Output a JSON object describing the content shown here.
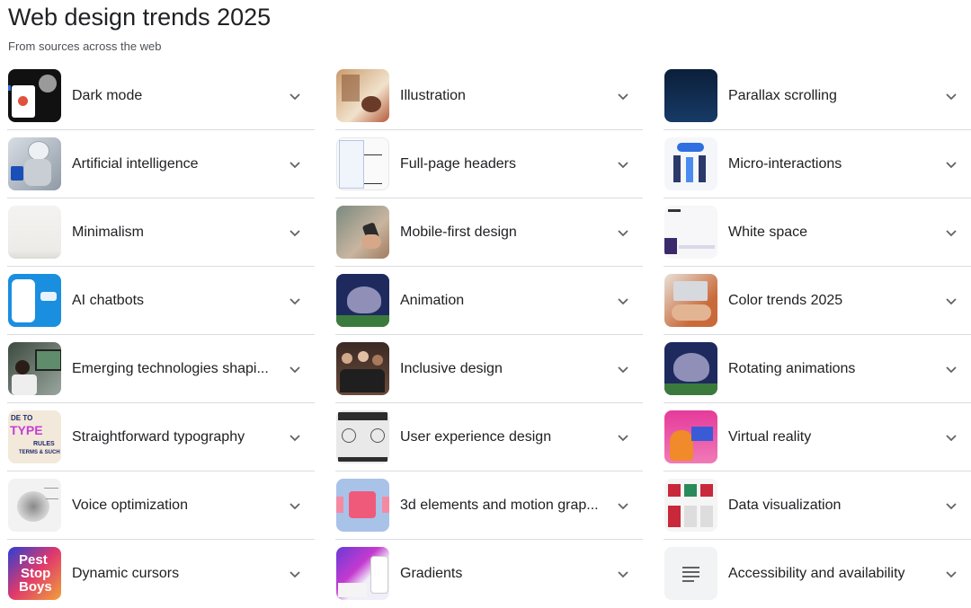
{
  "header": {
    "title": "Web design trends 2025",
    "subtitle": "From sources across the web"
  },
  "columns": [
    {
      "items": [
        {
          "label": "Dark mode",
          "thumb": "dark-mode-thumbnail"
        },
        {
          "label": "Artificial intelligence",
          "thumb": "robot-thumbnail"
        },
        {
          "label": "Minimalism",
          "thumb": "minimalism-thumbnail"
        },
        {
          "label": "AI chatbots",
          "thumb": "chatbot-thumbnail"
        },
        {
          "label": "Emerging technologies shapi...",
          "thumb": "workspace-thumbnail"
        },
        {
          "label": "Straightforward typography",
          "thumb": "typography-thumbnail",
          "thumb_text": [
            "DE TO",
            "TYPE",
            "RULES",
            "TERMS & SUCH"
          ]
        },
        {
          "label": "Voice optimization",
          "thumb": "voice-diagram-thumbnail"
        },
        {
          "label": "Dynamic cursors",
          "thumb": "pest-stop-boys-thumbnail",
          "thumb_text": [
            "Pest",
            "Stop",
            "Boys"
          ]
        }
      ]
    },
    {
      "items": [
        {
          "label": "Illustration",
          "thumb": "illustration-thumbnail"
        },
        {
          "label": "Full-page headers",
          "thumb": "wireframe-thumbnail"
        },
        {
          "label": "Mobile-first design",
          "thumb": "phone-hand-thumbnail"
        },
        {
          "label": "Animation",
          "thumb": "elephant-animation-thumbnail"
        },
        {
          "label": "Inclusive design",
          "thumb": "group-people-thumbnail"
        },
        {
          "label": "User experience design",
          "thumb": "ux-diagram-thumbnail"
        },
        {
          "label": "3d elements and motion grap...",
          "thumb": "pink-3d-thumbnail"
        },
        {
          "label": "Gradients",
          "thumb": "gradient-thumbnail"
        }
      ]
    },
    {
      "items": [
        {
          "label": "Parallax scrolling",
          "thumb": "parallax-thumbnail"
        },
        {
          "label": "Micro-interactions",
          "thumb": "people-illustration-thumbnail"
        },
        {
          "label": "White space",
          "thumb": "white-space-thumbnail"
        },
        {
          "label": "Color trends 2025",
          "thumb": "laptop-hands-thumbnail"
        },
        {
          "label": "Rotating animations",
          "thumb": "elephant-rotating-thumbnail"
        },
        {
          "label": "Virtual reality",
          "thumb": "vr-illustration-thumbnail"
        },
        {
          "label": "Data visualization",
          "thumb": "dataviz-thumbnail"
        },
        {
          "label": "Accessibility and availability",
          "thumb": "document-icon"
        }
      ]
    }
  ],
  "icons": {
    "expand": "chevron-down-icon"
  },
  "colors": {
    "text": "#202124",
    "subtle": "#4d5156",
    "divider": "#dadce0",
    "chevron": "#5f6368"
  }
}
